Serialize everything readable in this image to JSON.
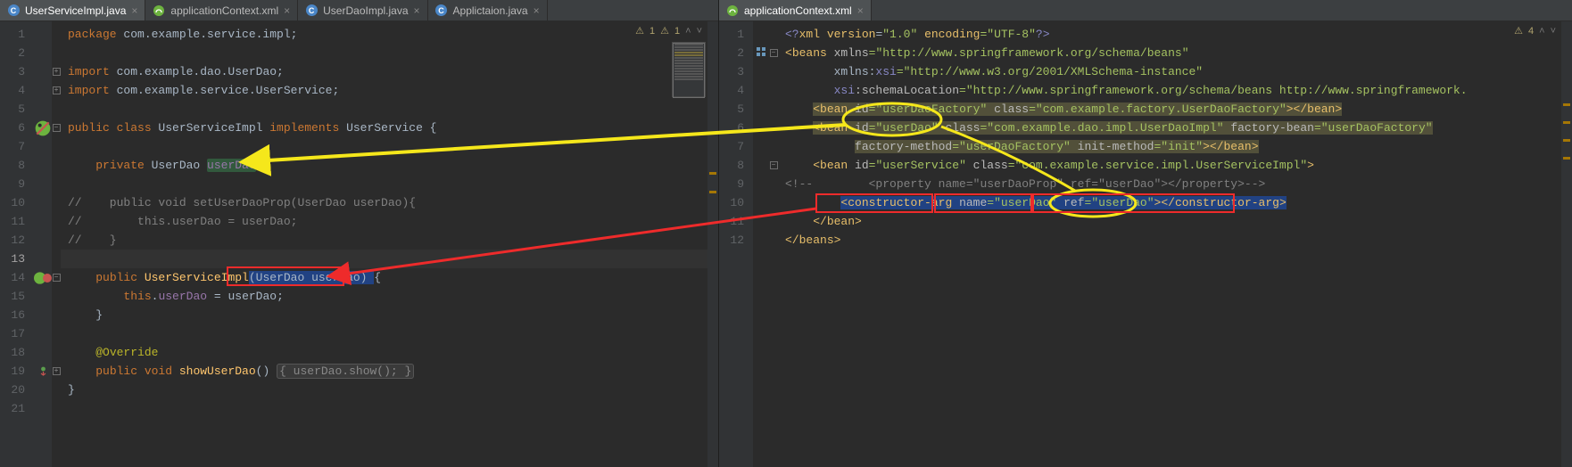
{
  "tabs_left": [
    {
      "label": "UserServiceImpl.java",
      "icon": "class",
      "active": true
    },
    {
      "label": "applicationContext.xml",
      "icon": "xml",
      "active": false
    },
    {
      "label": "UserDaoImpl.java",
      "icon": "class",
      "active": false
    },
    {
      "label": "Applictaion.java",
      "icon": "class",
      "active": false
    }
  ],
  "tabs_right": [
    {
      "label": "applicationContext.xml",
      "icon": "xml",
      "active": true
    }
  ],
  "left_warn": {
    "w1": "1",
    "w2": "1"
  },
  "right_warn": {
    "w1": "4"
  },
  "left_lines": [
    "1",
    "2",
    "3",
    "4",
    "5",
    "6",
    "7",
    "8",
    "9",
    "10",
    "11",
    "12",
    "13",
    "14",
    "15",
    "16",
    "17",
    "18",
    "19",
    "20",
    "21"
  ],
  "right_lines": [
    "1",
    "2",
    "3",
    "4",
    "5",
    "6",
    "7",
    "8",
    "9",
    "10",
    "11",
    "12"
  ],
  "java": {
    "l1_kw": "package",
    "l1_pkg": " com.example.service.impl;",
    "l3_kw": "import",
    "l3_pkg": " com.example.dao.UserDao;",
    "l4_kw": "import",
    "l4_pkg": " com.example.service.UserService;",
    "l6_kw1": "public class",
    "l6_cls": " UserServiceImpl ",
    "l6_kw2": "implements",
    "l6_if": " UserService {",
    "l8_kw": "private",
    "l8_type": " UserDao ",
    "l8_fld": "userDao",
    "l8_end": ";",
    "l9a": "//    public void setUserDaoProp(UserDao userDao){",
    "l9b": "//        this.userDao = userDao;",
    "l9c": "//    }",
    "l14_kw": "public",
    "l14_ctor": " UserServiceImpl",
    "l14_args": "(UserDao userDao) ",
    "l14_brace": "{",
    "l15_this": "this",
    "l15_dot": ".",
    "l15_fld": "userDao",
    "l15_eq": " = userDao;",
    "l16_brace": "}",
    "l18_ann": "@Override",
    "l19_kw": "public void",
    "l19_mth": " showUserDao",
    "l19_sig": "() ",
    "l19_body": "{ userDao.show(); }",
    "l20_brace": "}"
  },
  "xml": {
    "l1": {
      "a": "<?",
      "b": "xml version",
      "c": "=",
      "v1": "\"1.0\"",
      "d": " encoding",
      "v2": "=\"UTF-8\"",
      "e": "?>"
    },
    "l2": {
      "a": "<",
      "t": "beans",
      "b": " xmlns",
      "v": "=\"http://www.springframework.org/schema/beans\""
    },
    "l3": {
      "a": "       xmlns:",
      "ns": "xsi",
      "v": "=\"http://www.w3.org/2001/XMLSchema-instance\""
    },
    "l4": {
      "a": "       xsi",
      "b": ":schemaLocation",
      "v": "=\"http://www.springframework.org/schema/beans http://www.springframework."
    },
    "l5": {
      "pad": "    ",
      "a": "<",
      "t": "bean",
      "id_k": " id",
      "id_v": "=\"userDaoFactory\"",
      "cl_k": " class",
      "cl_v": "=\"com.example.factory.UserDaoFactory\"",
      "c": "></",
      "t2": "bean",
      "d": ">"
    },
    "l6": {
      "pad": "    ",
      "a": "<",
      "t": "bean",
      "id_k": " id",
      "id_v": "=\"userDao\"",
      "cl_k": " class",
      "cl_v": "=\"com.example.dao.impl.UserDaoImpl\"",
      "fb_k": " factory-bean",
      "fb_v": "=\"userDaoFactory\""
    },
    "l7": {
      "pad": "          ",
      "fm_k": "factory-method",
      "fm_v": "=\"userDaoFactory\"",
      "im_k": " init-method",
      "im_v": "=\"init\"",
      "c": "></",
      "t": "bean",
      "d": ">"
    },
    "l8": {
      "pad": "    ",
      "a": "<",
      "t": "bean",
      "id_k": " id",
      "id_v": "=\"userService\"",
      "cl_k": " class",
      "cl_v": "=\"com.example.service.impl.UserServiceImpl\"",
      "d": ">"
    },
    "l9": {
      "pad": "",
      "a": "<!--",
      "b": "        <property name=\"userDaoProp\" ref=\"userDao\"></property>",
      "c": "-->"
    },
    "l10": {
      "pad": "        ",
      "a": "<",
      "t": "constructor-arg",
      "nk": " name",
      "nv": "=\"userDao\"",
      "rk": " ref",
      "rv": "=\"userDao\"",
      "c": "></",
      "t2": "constructor-arg",
      "d": ">"
    },
    "l11": {
      "pad": "    ",
      "a": "</",
      "t": "bean",
      "b": ">"
    },
    "l12": {
      "a": "</",
      "t": "beans",
      "b": ">"
    }
  },
  "fold": {
    "minus": "−",
    "plus": "+"
  },
  "navs": {
    "up": "˄",
    "down": "˅"
  }
}
